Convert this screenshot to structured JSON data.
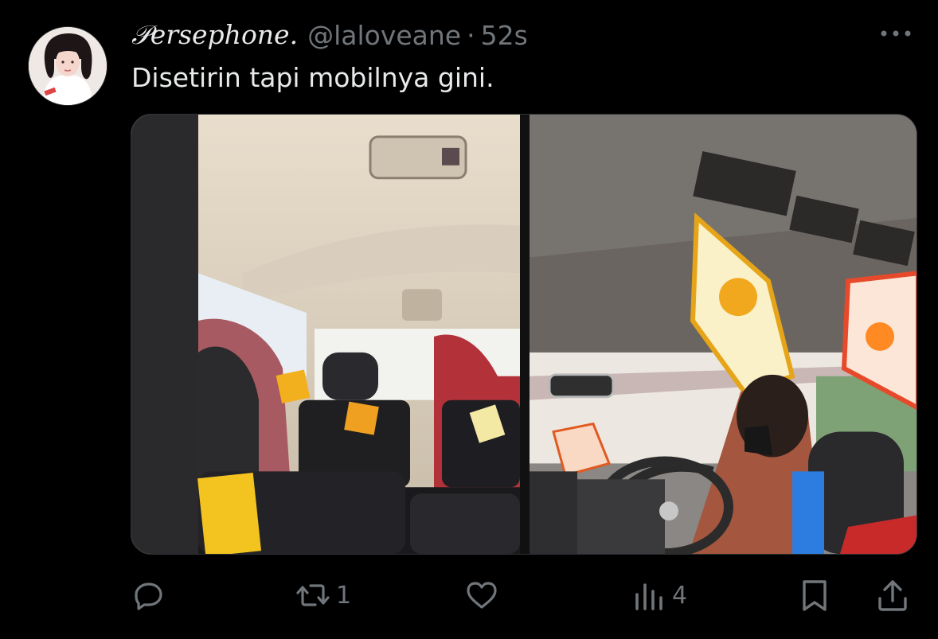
{
  "tweet": {
    "display_name": "𝒫ersephone.",
    "handle": "@laloveane",
    "separator": "·",
    "time": "52s",
    "text": "Disetirin tapi mobilnya gini.",
    "media": [
      {
        "description_icon": "photo-car-interior-rear"
      },
      {
        "description_icon": "photo-car-driver"
      }
    ]
  },
  "actions": {
    "reply_count": "",
    "retweet_count": "1",
    "like_count": "",
    "views_count": "4"
  },
  "colors": {
    "background": "#000000",
    "text_primary": "#e7e9ea",
    "text_secondary": "#71767b"
  },
  "icons": [
    "more-icon",
    "reply-icon",
    "retweet-icon",
    "like-icon",
    "views-icon",
    "bookmark-icon",
    "share-icon"
  ]
}
